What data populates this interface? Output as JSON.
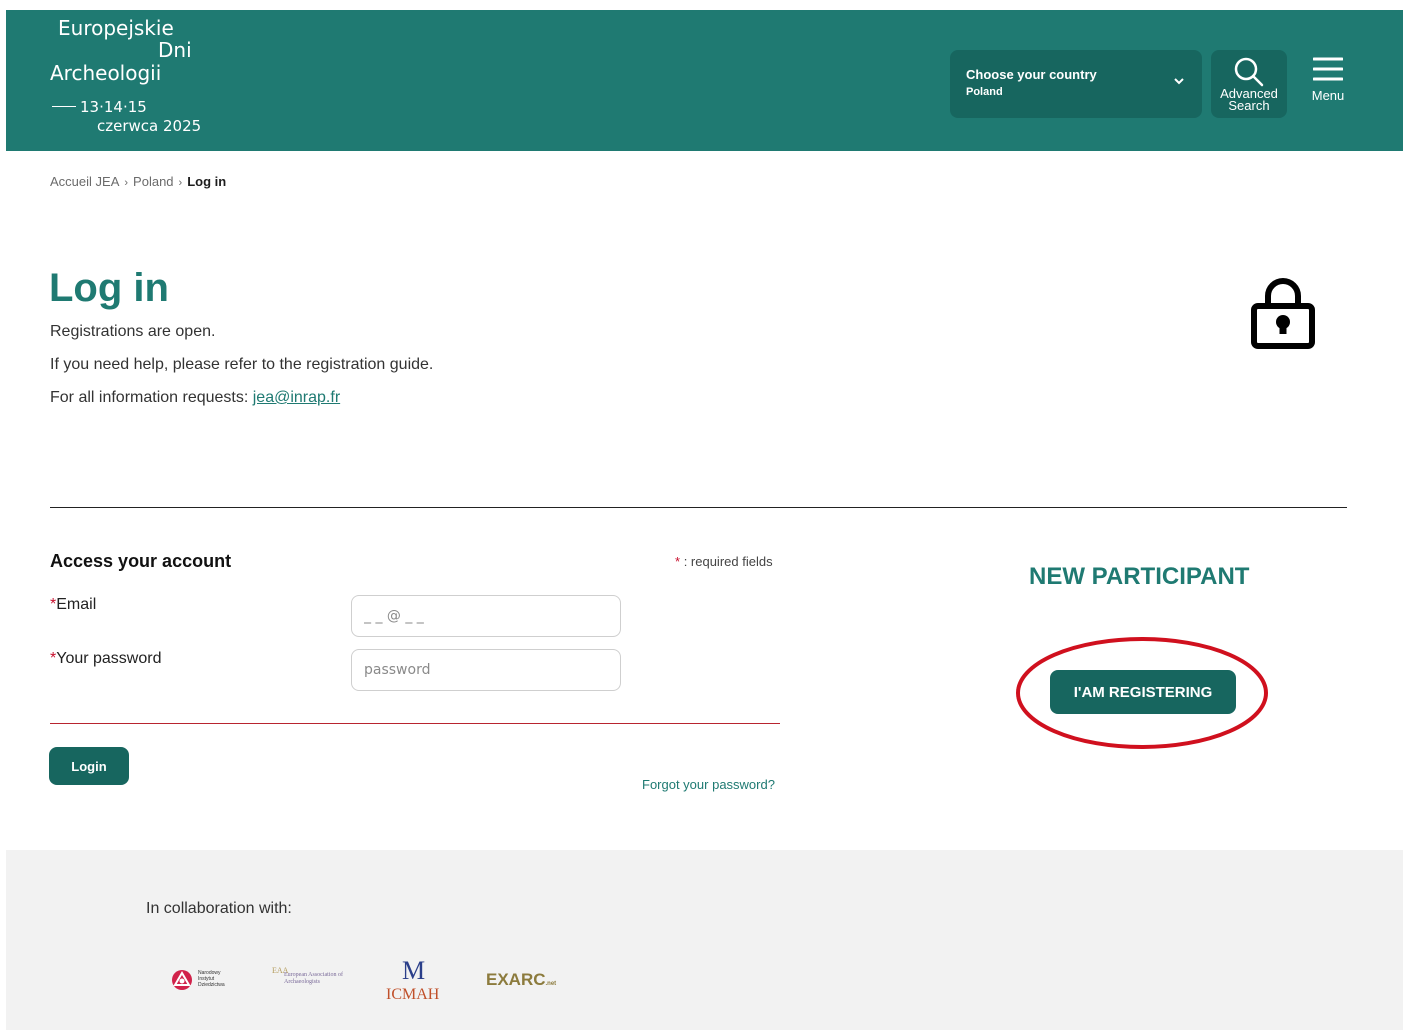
{
  "header": {
    "logo": {
      "line1": "Europejskie",
      "line2": "Dni",
      "line3": "Archeologii",
      "dates": "13·14·15",
      "month_year": "czerwca 2025"
    },
    "country_selector": {
      "label": "Choose your country",
      "value": "Poland",
      "icon": "chevron-down-icon"
    },
    "advanced_search": {
      "label": "Advanced Search",
      "icon": "search-icon"
    },
    "menu": {
      "label": "Menu",
      "icon": "hamburger-icon"
    },
    "brand_color": "#1f7a72"
  },
  "breadcrumb": {
    "items": [
      "Accueil JEA",
      "Poland",
      "Log in"
    ],
    "separator": "›"
  },
  "intro": {
    "title": "Log in",
    "line1": "Registrations are open.",
    "line2": "If you need help, please refer to the registration guide.",
    "line3_prefix": "For all information requests: ",
    "email_link": "jea@inrap.fr",
    "icon": "lock-icon"
  },
  "form": {
    "title": "Access your account",
    "required_star": "*",
    "required_note": ": required fields",
    "email_label": "Email",
    "email_placeholder": "_ _ @ _ _",
    "password_label": "Your password",
    "password_placeholder": "password",
    "login_button": "Login",
    "forgot_link": "Forgot your password?"
  },
  "new_participant": {
    "title": "NEW PARTICIPANT",
    "button": "I'AM REGISTERING",
    "highlight_color": "#d0101e"
  },
  "footer": {
    "collab_label": "In collaboration with:",
    "partners": [
      {
        "name": "Narodowy Instytut Dziedzictwa",
        "icon": "nid-logo-icon"
      },
      {
        "name": "European Association of Archaeologists",
        "letters": "EAA",
        "icon": "eaa-logo-icon"
      },
      {
        "name": "ICMAH",
        "mark": "M",
        "icon": "icmah-logo-icon"
      },
      {
        "name": "EXARC",
        "suffix": ".net",
        "icon": "exarc-logo-icon"
      }
    ]
  }
}
